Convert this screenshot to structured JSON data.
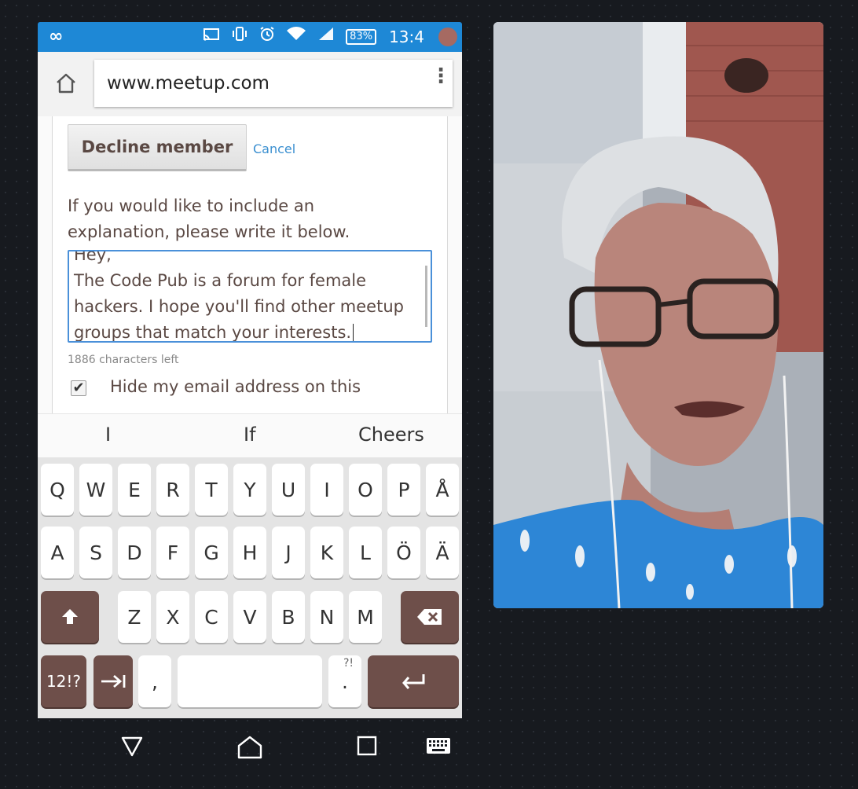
{
  "statusbar": {
    "left_icon": "infinity-icon",
    "battery": "83%",
    "time": "13:4",
    "icons": [
      "cast-icon",
      "vibrate-icon",
      "alarm-icon",
      "wifi-icon",
      "signal-icon"
    ]
  },
  "browser": {
    "url": "www.meetup.com"
  },
  "page": {
    "decline_label": "Decline member",
    "cancel_label": "Cancel",
    "explanation_prompt": "If you would like to include an explanation, please write it below.",
    "message_text": "Hey,\nThe Code Pub is a forum for female hackers. I hope you'll find other meetup groups that match your interests.",
    "chars_left": "1886 characters left",
    "hide_email_label": "Hide my email address on this",
    "hide_email_checked": true
  },
  "suggestions": [
    "I",
    "If",
    "Cheers"
  ],
  "keyboard": {
    "row1": [
      "Q",
      "W",
      "E",
      "R",
      "T",
      "Y",
      "U",
      "I",
      "O",
      "P",
      "Å"
    ],
    "row2": [
      "A",
      "S",
      "D",
      "F",
      "G",
      "H",
      "J",
      "K",
      "L",
      "Ö",
      "Ä"
    ],
    "row3": [
      "Z",
      "X",
      "C",
      "V",
      "B",
      "N",
      "M"
    ],
    "symbols_label": "12!?",
    "comma": ",",
    "period": ".",
    "period_sup": "?!"
  },
  "colors": {
    "statusbar": "#1e88d6",
    "key_dark": "#6e4f4a",
    "text": "#5a4843",
    "link": "#3a8fd0"
  }
}
